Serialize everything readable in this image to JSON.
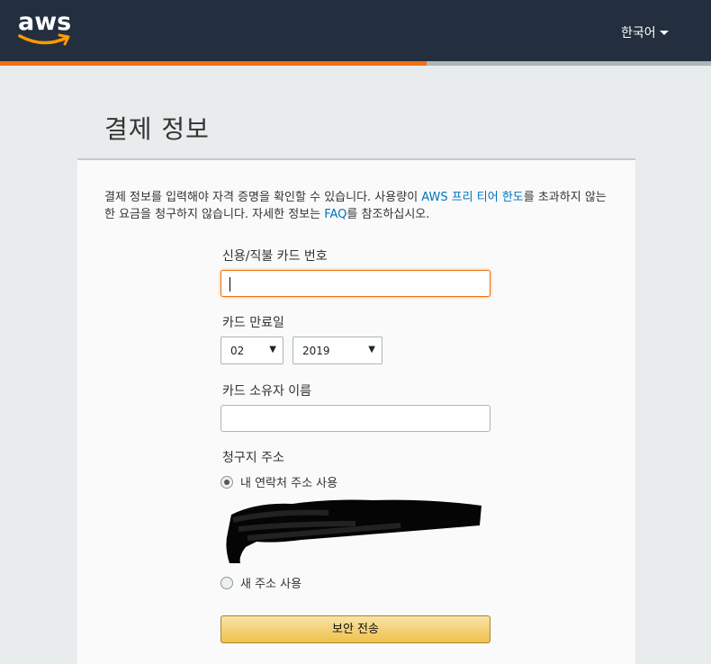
{
  "header": {
    "logo_text": "aws",
    "language_label": "한국어"
  },
  "progress": {
    "fraction": 0.6
  },
  "page": {
    "title": "결제 정보"
  },
  "intro": {
    "text_before_link1": "결제 정보를 입력해야 자격 증명을 확인할 수 있습니다. 사용량이 ",
    "link1": "AWS 프리 티어 한도",
    "text_after_link1": "를 초과하지 않는 한 요금을 청구하지 않습니다. 자세한 정보는 ",
    "link2": "FAQ",
    "text_after_link2": "를 참조하십시오."
  },
  "form": {
    "card_number_label": "신용/직불 카드 번호",
    "card_number_value": "",
    "expiry_label": "카드 만료일",
    "expiry_month": "02",
    "expiry_year": "2019",
    "holder_label": "카드 소유자 이름",
    "holder_value": "",
    "billing_label": "청구지 주소",
    "option_existing": "내 연락처 주소 사용",
    "option_new": "새 주소 사용",
    "submit_label": "보안 전송"
  },
  "colors": {
    "accent": "#ec7211",
    "link": "#0073bb",
    "header_bg": "#232f3e"
  }
}
